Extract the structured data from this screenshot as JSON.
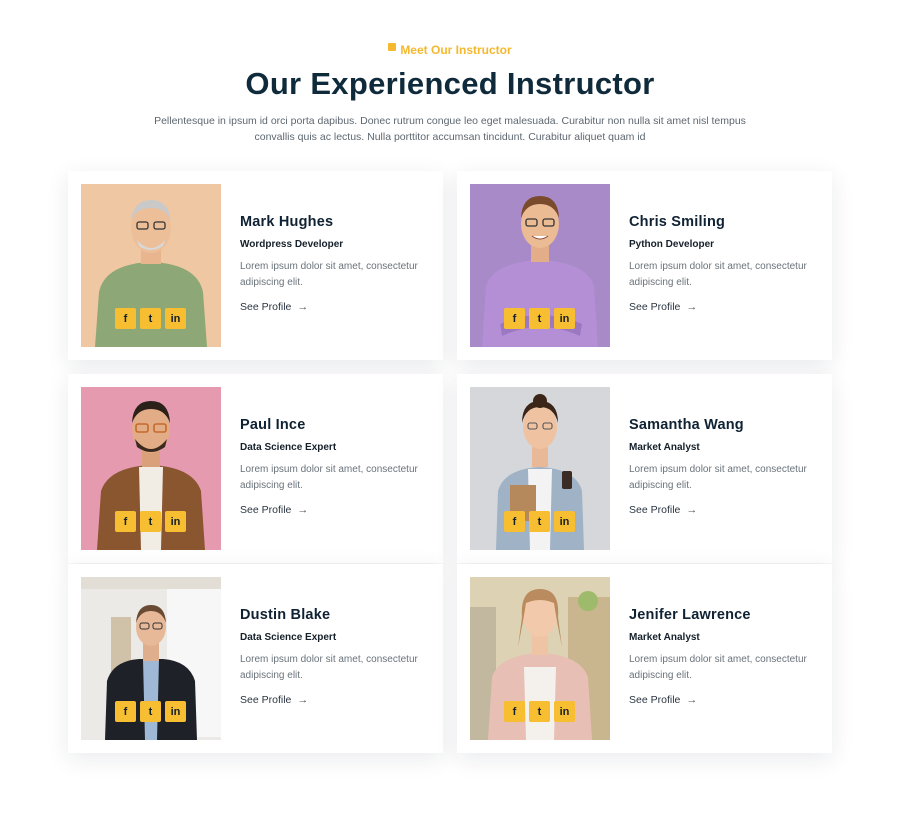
{
  "header": {
    "eyebrow": "Meet Our Instructor",
    "title": "Our Experienced Instructor",
    "subtitle": "Pellentesque in ipsum id orci porta dapibus. Donec rutrum congue leo eget malesuada. Curabitur non nulla sit amet nisl tempus convallis quis ac lectus. Nulla porttitor accumsan tincidunt. Curabitur aliquet quam id"
  },
  "social": {
    "facebook": "f",
    "twitter": "t",
    "linkedin": "in"
  },
  "colors": {
    "accent": "#f6be30",
    "heading": "#0f2a3a",
    "text": "#6a737b"
  },
  "instructors": [
    {
      "name": "Mark Hughes",
      "role": "Wordpress Developer",
      "desc": "Lorem ipsum dolor sit amet, consectetur adipiscing elit.",
      "link": "See Profile"
    },
    {
      "name": "Chris Smiling",
      "role": "Python Developer",
      "desc": "Lorem ipsum dolor sit amet, consectetur adipiscing elit.",
      "link": "See Profile"
    },
    {
      "name": "Paul Ince",
      "role": "Data Science Expert",
      "desc": "Lorem ipsum dolor sit amet, consectetur adipiscing elit.",
      "link": "See Profile"
    },
    {
      "name": "Samantha Wang",
      "role": "Market Analyst",
      "desc": "Lorem ipsum dolor sit amet, consectetur adipiscing elit.",
      "link": "See Profile"
    },
    {
      "name": "Dustin Blake",
      "role": "Data Science Expert",
      "desc": "Lorem ipsum dolor sit amet, consectetur adipiscing elit.",
      "link": "See Profile"
    },
    {
      "name": "Jenifer Lawrence",
      "role": "Market Analyst",
      "desc": "Lorem ipsum dolor sit amet, consectetur adipiscing elit.",
      "link": "See Profile"
    }
  ]
}
